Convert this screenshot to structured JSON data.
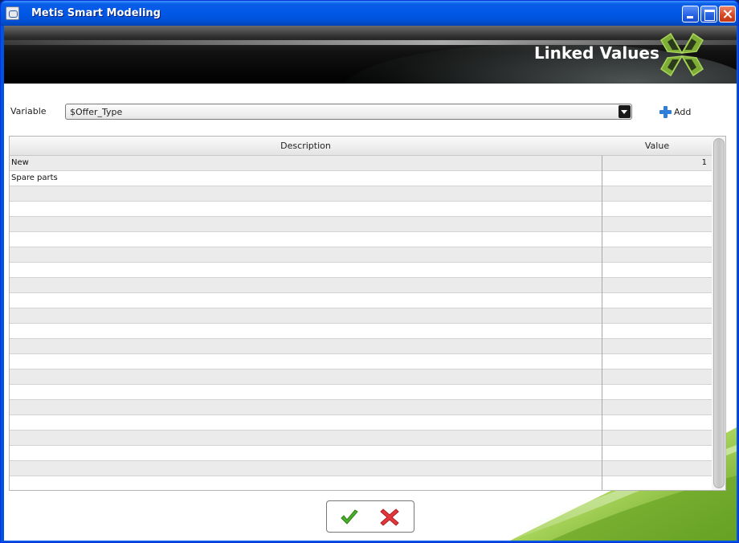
{
  "window": {
    "title": "Metis Smart Modeling"
  },
  "banner": {
    "title": "Linked Values",
    "logo_icon": "metis-logo-icon"
  },
  "variable": {
    "label": "Variable",
    "selected": "$Offer_Type",
    "add_label": "Add"
  },
  "table": {
    "columns": [
      "Description",
      "Value"
    ],
    "rows": [
      {
        "description": "New",
        "value": "1"
      },
      {
        "description": "Spare parts",
        "value": ""
      },
      {
        "description": "",
        "value": ""
      },
      {
        "description": "",
        "value": ""
      },
      {
        "description": "",
        "value": ""
      },
      {
        "description": "",
        "value": ""
      },
      {
        "description": "",
        "value": ""
      },
      {
        "description": "",
        "value": ""
      },
      {
        "description": "",
        "value": ""
      },
      {
        "description": "",
        "value": ""
      },
      {
        "description": "",
        "value": ""
      },
      {
        "description": "",
        "value": ""
      },
      {
        "description": "",
        "value": ""
      },
      {
        "description": "",
        "value": ""
      },
      {
        "description": "",
        "value": ""
      },
      {
        "description": "",
        "value": ""
      },
      {
        "description": "",
        "value": ""
      },
      {
        "description": "",
        "value": ""
      },
      {
        "description": "",
        "value": ""
      },
      {
        "description": "",
        "value": ""
      },
      {
        "description": "",
        "value": ""
      },
      {
        "description": "",
        "value": ""
      }
    ]
  },
  "actions": {
    "confirm_icon": "checkmark-icon",
    "cancel_icon": "red-x-icon"
  },
  "colors": {
    "accent_green": "#8dc63f",
    "title_blue": "#0058e6",
    "header_black": "#121212"
  }
}
